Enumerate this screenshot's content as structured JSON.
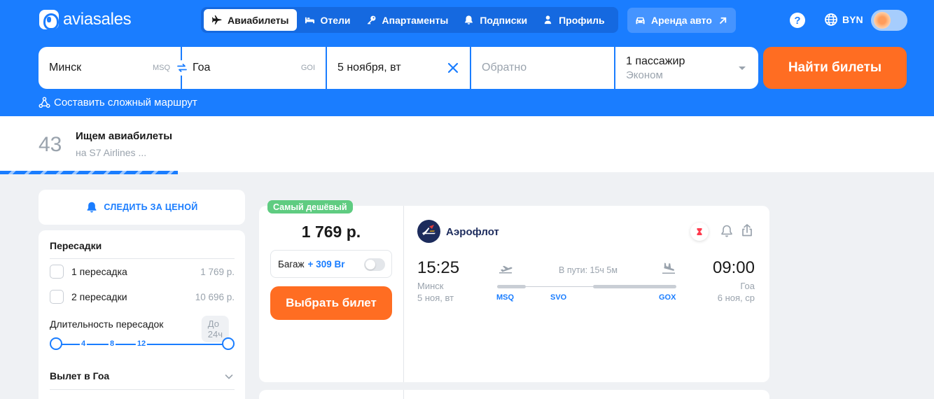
{
  "brand": {
    "name": "aviasales"
  },
  "nav": {
    "items": [
      {
        "label": "Авиабилеты",
        "icon": "plane-icon",
        "active": true
      },
      {
        "label": "Отели",
        "icon": "bed-icon",
        "active": false
      },
      {
        "label": "Апартаменты",
        "icon": "key-icon",
        "active": false
      },
      {
        "label": "Подписки",
        "icon": "bell-icon",
        "active": false
      },
      {
        "label": "Профиль",
        "icon": "person-icon",
        "active": false
      }
    ],
    "external": {
      "label": "Аренда авто",
      "icon": "car-icon"
    }
  },
  "header": {
    "help_label": "?",
    "currency": "BYN"
  },
  "search": {
    "from": {
      "city": "Минск",
      "iata": "MSQ"
    },
    "to": {
      "city": "Гоа",
      "iata": "GOI"
    },
    "date": "5 ноября, вт",
    "return_placeholder": "Обратно",
    "passengers": "1 пассажир",
    "cabin_class": "Эконом",
    "submit_label": "Найти билеты",
    "complex_route_label": "Составить сложный маршрут"
  },
  "progress_banner": {
    "count": "43",
    "title": "Ищем авиабилеты",
    "subtitle": "на S7 Airlines ..."
  },
  "filters": {
    "track_price_label": "СЛЕДИТЬ ЗА ЦЕНОЙ",
    "stops": {
      "heading": "Пересадки",
      "options": [
        {
          "label": "1 пересадка",
          "price": "1 769 р.",
          "checked": false
        },
        {
          "label": "2 пересадки",
          "price": "10 696 р.",
          "checked": false
        }
      ]
    },
    "layover": {
      "label": "Длительность пересадок",
      "badge": "До 24ч",
      "ticks": [
        "4",
        "8",
        "12"
      ]
    },
    "departure_heading": "Вылет в Гоа"
  },
  "ticket": {
    "badge": "Самый дешёвый",
    "price": "1 769 р.",
    "baggage_label": "Багаж",
    "baggage_price": "+ 309 Br",
    "select_label": "Выбрать билет",
    "airline": "Аэрофлот",
    "departure": {
      "time": "15:25",
      "city": "Минск",
      "date": "5 ноя, вт"
    },
    "arrival": {
      "time": "09:00",
      "city": "Гоа",
      "date": "6 ноя, ср"
    },
    "duration": "В пути: 15ч 5м",
    "stops": [
      "MSQ",
      "SVO",
      "GOX"
    ]
  },
  "colors": {
    "primary": "#1a7dff",
    "accent": "#ff6d22",
    "badge_green": "#5fcc81",
    "muted": "#9aa3ad",
    "airline_navy": "#1c2b5c"
  }
}
